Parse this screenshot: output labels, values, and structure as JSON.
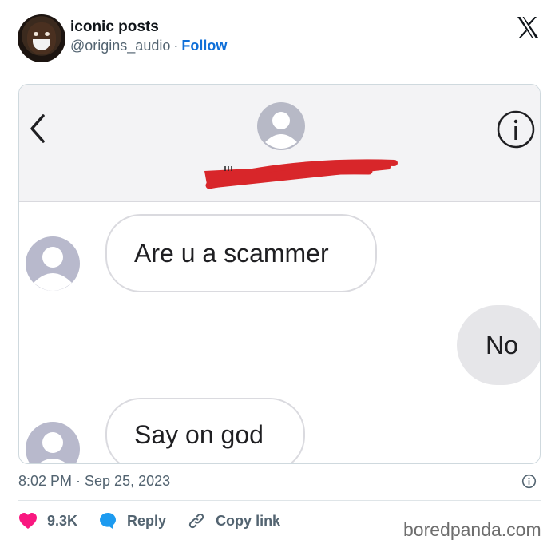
{
  "post": {
    "display_name": "iconic posts",
    "handle": "@origins_audio",
    "separator": "·",
    "follow_label": "Follow",
    "timestamp": "8:02 PM · Sep 25, 2023"
  },
  "media": {
    "messages": [
      {
        "direction": "incoming",
        "text": "Are u a scammer"
      },
      {
        "direction": "outgoing",
        "text": "No"
      },
      {
        "direction": "incoming",
        "text": "Say on god"
      }
    ]
  },
  "actions": {
    "likes": "9.3K",
    "reply_label": "Reply",
    "copy_link_label": "Copy link"
  },
  "watermark": "boredpanda.com",
  "colors": {
    "link_blue": "#0f6fd8",
    "like_pink": "#f91880",
    "reply_blue": "#1d9bf0",
    "redaction_red": "#d8262a",
    "muted_text": "#536471"
  },
  "icons": [
    "x-logo-icon",
    "back-chevron-icon",
    "contact-avatar-icon",
    "info-icon",
    "heart-icon",
    "reply-bubble-icon",
    "link-icon"
  ]
}
